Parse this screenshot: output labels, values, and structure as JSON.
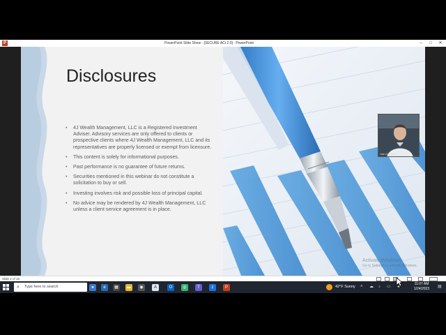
{
  "window": {
    "title": "PowerPoint Slide Show - [SECURE ACt 2.0] - PowerPoint",
    "app_icon": "P",
    "controls": [
      "–",
      "□",
      "✕"
    ]
  },
  "slide": {
    "title": "Disclosures",
    "bullets": [
      "4J Wealth Management, LLC is a Registered Investment Adviser. Advisory services are only offered to clients or prospective clients where 4J Wealth Management, LLC and its representatives are properly licensed or exempt from licensure.",
      "This content is solely for informational purposes.",
      "Past performance is no guarantee of future returns.",
      "Securities mentioned in this webinar do not constitute a solicitation to buy or sell.",
      "Investing involves risk and possible loss of principal capital.",
      "No advice may be rendered by 4J Wealth Management, LLC unless a client service agreement is in place."
    ],
    "colors": {
      "accent": "#4a90d9",
      "panel": "#f2f2f2",
      "wave": "#c8d8e8"
    }
  },
  "watermark": {
    "title": "Activate Windows",
    "subtitle": "Go to Settings to activate Windows."
  },
  "webcam": {
    "name": "Josh Goulding"
  },
  "statusbar": {
    "slide_indicator": "Slide 2 of 16"
  },
  "taskbar": {
    "search_placeholder": "Type here to search",
    "weather": "42°F  Sunny",
    "time": "11:07 AM",
    "date": "1/24/2023"
  }
}
